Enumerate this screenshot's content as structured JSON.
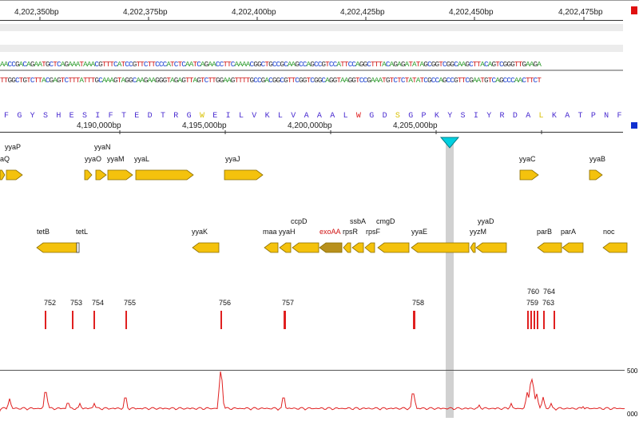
{
  "top_ruler": {
    "ticks": [
      "4,202,350bp",
      "4,202,375bp",
      "4,202,400bp",
      "4,202,425bp",
      "4,202,450bp",
      "4,202,475bp"
    ]
  },
  "dna": {
    "forward": "AACCGACAGAATGCTCAGAAATAAACGTTTCATCCGTTCTTCCCATCTCAATCAGAACCTTCAAAACGGCTGCCGCAAGCCAGCCGTCCATTCCAGGCTTTACAGAGATATAGCGGTCGGCAAGCTTACAGTCGGGTTGAAGA",
    "reverse": "TTGGCTGTCTTACGAGTCTTTATTTGCAAAGTAGGCAAGAAGGGTAGAGTTAGTCTTGGAAGTTTTGCCGACGGCGTTCGGTCGGCAGGTAAGGTCCGAAATGTCTCTATATCGCCAGCCGTTCGAATGTCAGCCCAACTTCT"
  },
  "protein": {
    "residues": [
      "F",
      "G",
      "Y",
      "S",
      "H",
      "E",
      "S",
      "I",
      "F",
      "T",
      "E",
      "D",
      "T",
      "R",
      "G",
      "W",
      "E",
      "I",
      "L",
      "V",
      "K",
      "L",
      "V",
      "A",
      "A",
      "A",
      "L",
      "W",
      "G",
      "D",
      "S",
      "G",
      "P",
      "K",
      "Y",
      "S",
      "I",
      "Y",
      "R",
      "D",
      "A",
      "L",
      "K",
      "A",
      "T",
      "P",
      "N",
      "F"
    ]
  },
  "genome_ruler": {
    "ticks": [
      "4,190,000bp",
      "4,195,000bp",
      "4,200,000bp",
      "4,205,000bp"
    ]
  },
  "genes_top": [
    {
      "label": "aQ"
    },
    {
      "label": "yyaO"
    },
    {
      "label": "yyaM"
    },
    {
      "label": "yyaL"
    },
    {
      "label": "yyaJ"
    },
    {
      "label": "yyaC"
    },
    {
      "label": "yyaB"
    }
  ],
  "genes_top_overlap": [
    "yyaP",
    "yyaN"
  ],
  "genes_bottom": [
    {
      "label": "tetB"
    },
    {
      "label": "tetL"
    },
    {
      "label": "yyaK"
    },
    {
      "label": "maa"
    },
    {
      "label": "yyaH"
    },
    {
      "label": "exoAA"
    },
    {
      "label": "rpsR"
    },
    {
      "label": "rpsF"
    },
    {
      "label": "yyaE"
    },
    {
      "label": "yyzM"
    },
    {
      "label": "parB"
    },
    {
      "label": "parA"
    },
    {
      "label": "noc"
    }
  ],
  "genes_bottom_overlap": [
    "ccpD",
    "ssbA",
    "cmgD",
    "yyaD"
  ],
  "features": {
    "labels": [
      "752",
      "753",
      "754",
      "755",
      "756",
      "757",
      "758",
      "759",
      "763"
    ],
    "overlap_labels": [
      "760",
      "764"
    ]
  },
  "signal": {
    "max_label": "500",
    "min_label": "000"
  },
  "colors": {
    "gene_fill": "#f4c20d",
    "gene_stroke": "#8a6d00",
    "highlight_gene": "#b8901c",
    "feature_red": "#e02020",
    "signal_red": "#e02020",
    "marker_cyan": "#00d0e0",
    "highlight_label": "#d01010"
  }
}
